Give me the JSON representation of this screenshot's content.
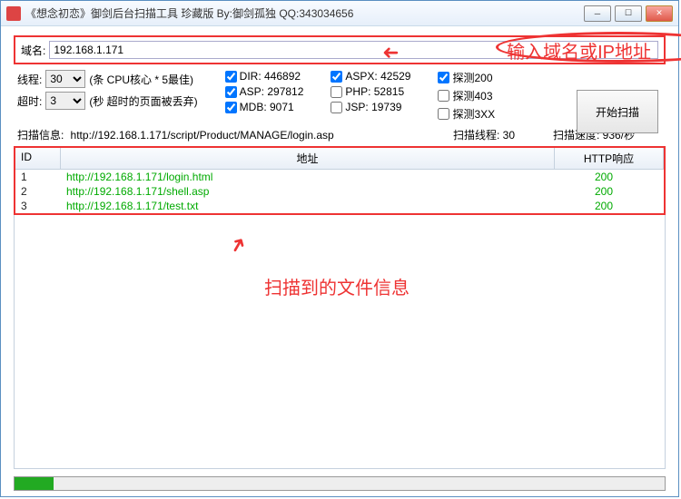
{
  "window": {
    "title": "《想念初恋》御剑后台扫描工具 珍藏版 By:御剑孤独 QQ:343034656"
  },
  "domain": {
    "label": "域名:",
    "value": "192.168.1.171"
  },
  "thread": {
    "label": "线程:",
    "value": "30",
    "hint": "(条 CPU核心 * 5最佳)"
  },
  "timeout": {
    "label": "超时:",
    "value": "3",
    "hint": "(秒 超时的页面被丢弃)"
  },
  "dict_checks": {
    "dir": {
      "label": "DIR: 446892",
      "checked": true
    },
    "asp": {
      "label": "ASP: 297812",
      "checked": true
    },
    "mdb": {
      "label": "MDB: 9071",
      "checked": true
    },
    "aspx": {
      "label": "ASPX: 42529",
      "checked": true
    },
    "php": {
      "label": "PHP: 52815",
      "checked": false
    },
    "jsp": {
      "label": "JSP: 19739",
      "checked": false
    },
    "p200": {
      "label": "探测200",
      "checked": true
    },
    "p403": {
      "label": "探测403",
      "checked": false
    },
    "p3xx": {
      "label": "探测3XX",
      "checked": false
    }
  },
  "start_btn": "开始扫描",
  "status": {
    "info_label": "扫描信息:",
    "info_value": "http://192.168.1.171/script/Product/MANAGE/login.asp",
    "thread_label": "扫描线程: 30",
    "speed_label": "扫描速度: 936/秒"
  },
  "columns": {
    "id": "ID",
    "addr": "地址",
    "resp": "HTTP响应"
  },
  "rows": [
    {
      "id": "1",
      "addr": "http://192.168.1.171/login.html",
      "resp": "200"
    },
    {
      "id": "2",
      "addr": "http://192.168.1.171/shell.asp",
      "resp": "200"
    },
    {
      "id": "3",
      "addr": "http://192.168.1.171/test.txt",
      "resp": "200"
    }
  ],
  "annotations": {
    "a1": "输入域名或IP地址",
    "a2": "扫描到的文件信息"
  }
}
